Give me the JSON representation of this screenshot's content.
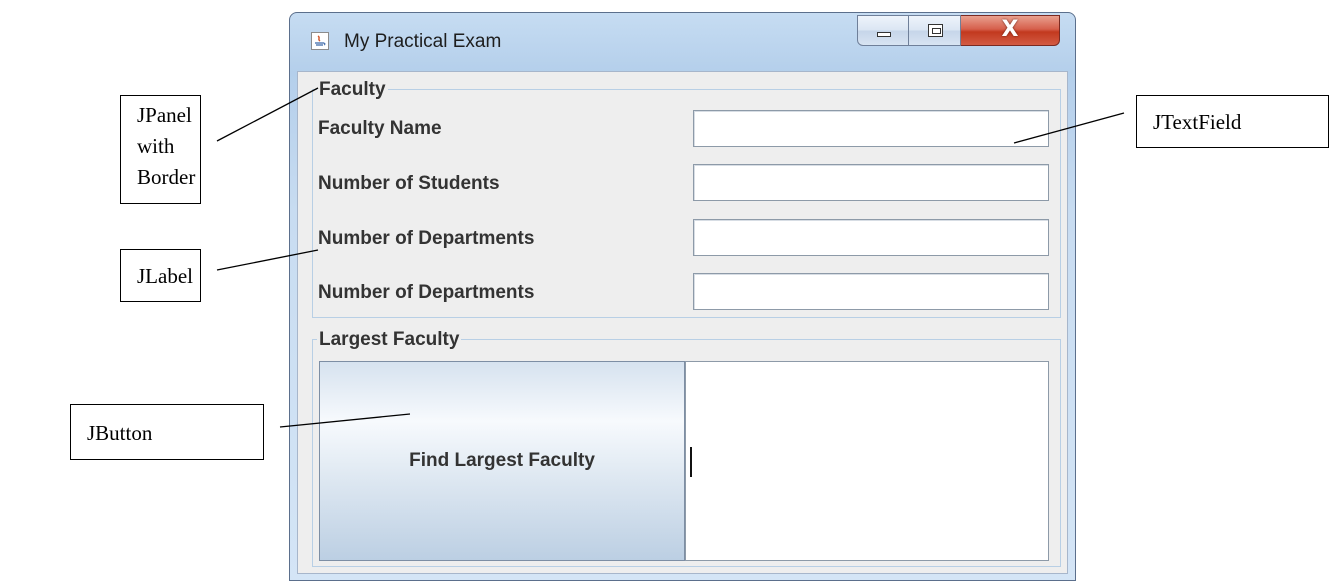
{
  "window": {
    "title": "My Practical Exam",
    "close_glyph": "X",
    "icons": [
      "java-app-icon",
      "minimize-icon",
      "maximize-icon",
      "close-icon"
    ]
  },
  "faculty_panel": {
    "legend": "Faculty",
    "rows": [
      {
        "label": "Faculty Name",
        "value": ""
      },
      {
        "label": "Number of Students",
        "value": ""
      },
      {
        "label": "Number of Departments",
        "value": ""
      },
      {
        "label": "Number of Departments",
        "value": ""
      }
    ]
  },
  "largest_panel": {
    "legend": "Largest Faculty",
    "button_label": "Find Largest Faculty",
    "output_text": ""
  },
  "annotations": {
    "panel": "JPanel with Border",
    "label": "JLabel",
    "button": "JButton",
    "textfield": "JTextField"
  }
}
